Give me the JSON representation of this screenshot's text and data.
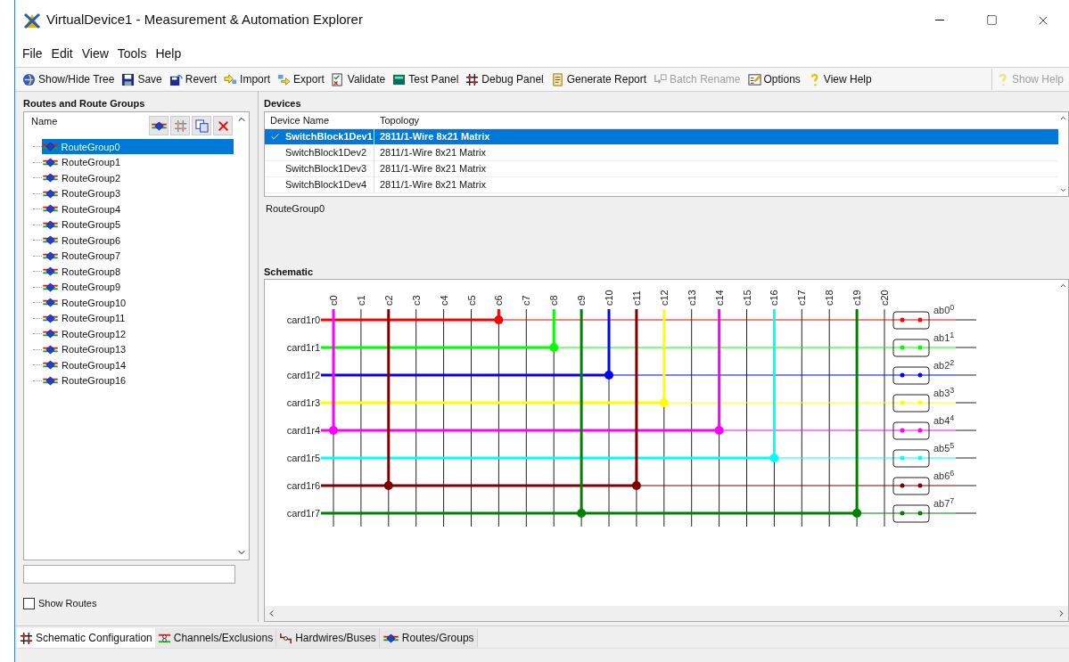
{
  "window": {
    "title": "VirtualDevice1 - Measurement & Automation Explorer"
  },
  "menu": [
    "File",
    "Edit",
    "View",
    "Tools",
    "Help"
  ],
  "toolbar": [
    {
      "label": "Show/Hide Tree",
      "disabled": false
    },
    {
      "label": "Save",
      "disabled": false
    },
    {
      "label": "Revert",
      "disabled": false
    },
    {
      "label": "Import",
      "disabled": false
    },
    {
      "label": "Export",
      "disabled": false
    },
    {
      "label": "Validate",
      "disabled": false
    },
    {
      "label": "Test Panel",
      "disabled": false
    },
    {
      "label": "Debug Panel",
      "disabled": false
    },
    {
      "label": "Generate Report",
      "disabled": false
    },
    {
      "label": "Batch Rename",
      "disabled": true
    },
    {
      "label": "Options",
      "disabled": false
    },
    {
      "label": "View Help",
      "disabled": false
    }
  ],
  "help_button": {
    "label": "Show Help",
    "disabled": true
  },
  "routes_panel": {
    "title": "Routes and Route Groups",
    "column": "Name",
    "items": [
      {
        "label": "RouteGroup0",
        "selected": true
      },
      {
        "label": "RouteGroup1",
        "selected": false
      },
      {
        "label": "RouteGroup2",
        "selected": false
      },
      {
        "label": "RouteGroup3",
        "selected": false
      },
      {
        "label": "RouteGroup4",
        "selected": false
      },
      {
        "label": "RouteGroup5",
        "selected": false
      },
      {
        "label": "RouteGroup6",
        "selected": false
      },
      {
        "label": "RouteGroup7",
        "selected": false
      },
      {
        "label": "RouteGroup8",
        "selected": false
      },
      {
        "label": "RouteGroup9",
        "selected": false
      },
      {
        "label": "RouteGroup10",
        "selected": false
      },
      {
        "label": "RouteGroup11",
        "selected": false
      },
      {
        "label": "RouteGroup12",
        "selected": false
      },
      {
        "label": "RouteGroup13",
        "selected": false
      },
      {
        "label": "RouteGroup14",
        "selected": false
      },
      {
        "label": "RouteGroup16",
        "selected": false
      }
    ],
    "show_routes": {
      "label": "Show Routes",
      "checked": false
    }
  },
  "devices": {
    "title": "Devices",
    "columns": [
      "Device Name",
      "Topology"
    ],
    "rows": [
      {
        "name": "SwitchBlock1Dev1",
        "topology": "2811/1-Wire 8x21 Matrix",
        "selected": true
      },
      {
        "name": "SwitchBlock1Dev2",
        "topology": "2811/1-Wire 8x21 Matrix",
        "selected": false
      },
      {
        "name": "SwitchBlock1Dev3",
        "topology": "2811/1-Wire 8x21 Matrix",
        "selected": false
      },
      {
        "name": "SwitchBlock1Dev4",
        "topology": "2811/1-Wire 8x21 Matrix",
        "selected": false
      }
    ],
    "current_group": "RouteGroup0"
  },
  "schematic": {
    "title": "Schematic",
    "columns": [
      "c0",
      "c1",
      "c2",
      "c3",
      "c4",
      "c5",
      "c6",
      "c7",
      "c8",
      "c9",
      "c10",
      "c11",
      "c12",
      "c13",
      "c14",
      "c15",
      "c16",
      "c17",
      "c18",
      "c19",
      "c20"
    ],
    "rows": [
      {
        "label": "card1r0",
        "color": "#ff0000",
        "bus": "ab0$^{0}$",
        "closed": [
          false,
          false,
          false,
          false,
          false,
          false,
          true,
          false,
          false,
          false,
          false,
          false,
          false,
          false,
          false,
          false,
          false,
          false,
          false,
          false,
          false
        ]
      },
      {
        "label": "card1r1",
        "color": "#00ff00",
        "bus": "ab1$^{1}$",
        "closed": [
          false,
          false,
          false,
          false,
          false,
          false,
          false,
          false,
          true,
          false,
          false,
          false,
          false,
          false,
          false,
          false,
          false,
          false,
          false,
          false,
          false
        ]
      },
      {
        "label": "card1r2",
        "color": "#0000ff",
        "bus": "ab2$^{2}$",
        "closed": [
          false,
          false,
          false,
          false,
          false,
          false,
          false,
          false,
          false,
          false,
          true,
          false,
          false,
          false,
          false,
          false,
          false,
          false,
          false,
          false,
          false
        ]
      },
      {
        "label": "card1r3",
        "color": "#ffff00",
        "bus": "ab3$^{3}$",
        "closed": [
          false,
          false,
          false,
          false,
          false,
          false,
          false,
          false,
          false,
          false,
          false,
          false,
          true,
          false,
          false,
          false,
          false,
          false,
          false,
          false,
          false
        ]
      },
      {
        "label": "card1r4",
        "color": "#ff00ff",
        "bus": "ab4$^{4}$",
        "closed": [
          true,
          false,
          false,
          false,
          false,
          false,
          false,
          false,
          false,
          false,
          false,
          false,
          false,
          false,
          true,
          false,
          false,
          false,
          false,
          false,
          false
        ]
      },
      {
        "label": "card1r5",
        "color": "#00ffff",
        "bus": "ab5$^{5}$",
        "closed": [
          false,
          false,
          false,
          false,
          false,
          false,
          false,
          false,
          false,
          false,
          false,
          false,
          false,
          false,
          false,
          false,
          true,
          false,
          false,
          false,
          false
        ]
      },
      {
        "label": "card1r6",
        "color": "#800000",
        "bus": "ab6$^{6}$",
        "closed": [
          false,
          false,
          true,
          false,
          false,
          false,
          false,
          false,
          false,
          false,
          false,
          true,
          false,
          false,
          false,
          false,
          false,
          false,
          false,
          false,
          false
        ]
      },
      {
        "label": "card1r7",
        "color": "#008000",
        "bus": "ab7$^{7}$",
        "closed": [
          false,
          false,
          false,
          false,
          false,
          false,
          false,
          false,
          false,
          true,
          false,
          false,
          false,
          false,
          false,
          false,
          false,
          false,
          false,
          true,
          false
        ]
      }
    ]
  },
  "bottom_tabs": [
    {
      "label": "Schematic Configuration",
      "selected": true
    },
    {
      "label": "Channels/Exclusions",
      "selected": false
    },
    {
      "label": "Hardwires/Buses",
      "selected": false
    },
    {
      "label": "Routes/Groups",
      "selected": false
    }
  ]
}
